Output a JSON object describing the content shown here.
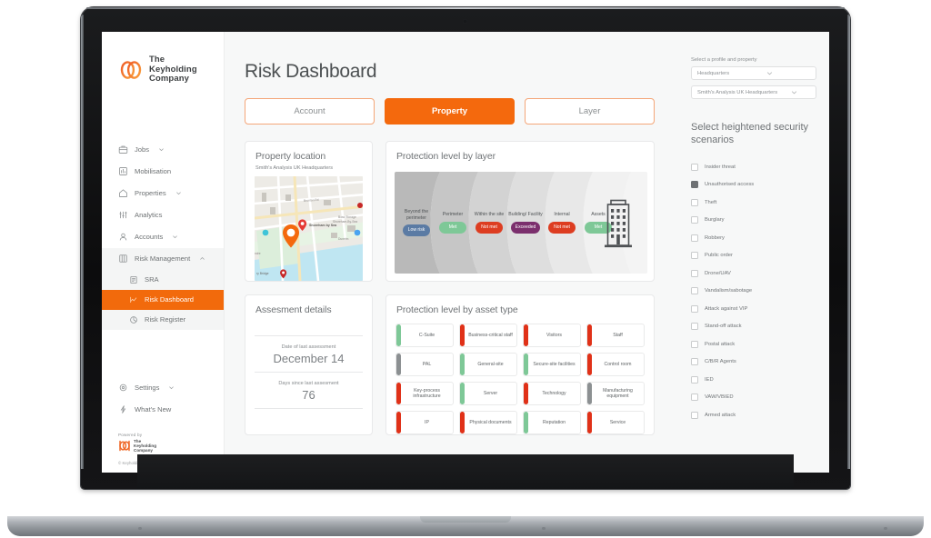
{
  "brand": {
    "logo_line1": "The",
    "logo_line2": "Keyholding",
    "logo_line3": "Company",
    "accent": "#f4690d",
    "powered_by": "Powered by",
    "copyright": "© Keyholding Technology"
  },
  "sidebar": {
    "items": [
      {
        "label": "Jobs",
        "icon": "briefcase-icon",
        "chevron": "down"
      },
      {
        "label": "Mobilisation",
        "icon": "bar-chart-icon",
        "chevron": "none"
      },
      {
        "label": "Properties",
        "icon": "home-icon",
        "chevron": "down"
      },
      {
        "label": "Analytics",
        "icon": "analytics-icon",
        "chevron": "none"
      },
      {
        "label": "Accounts",
        "icon": "user-icon",
        "chevron": "down"
      },
      {
        "label": "Risk Management",
        "icon": "columns-icon",
        "chevron": "up"
      }
    ],
    "sub_items": [
      {
        "label": "SRA",
        "icon": "document-icon",
        "active": false
      },
      {
        "label": "Risk Dashboard",
        "icon": "line-chart-icon",
        "active": true
      },
      {
        "label": "Risk Register",
        "icon": "pie-chart-icon",
        "active": false
      }
    ],
    "bottom_items": [
      {
        "label": "Settings",
        "icon": "gear-icon",
        "chevron": "down"
      },
      {
        "label": "What's New",
        "icon": "lightning-icon",
        "chevron": "none"
      }
    ]
  },
  "main": {
    "page_title": "Risk Dashboard",
    "tabs": [
      {
        "label": "Account",
        "active": false
      },
      {
        "label": "Property",
        "active": true
      },
      {
        "label": "Layer",
        "active": false
      }
    ],
    "property_location": {
      "title": "Property location",
      "subtitle": "Smith's Analysis UK Headquarters",
      "map_labels": [
        "Brunton Rd",
        "Shoreham by Sea",
        "Boss Storage Shoreham-By-Sea",
        "Dunelm",
        "Ferry Bridge"
      ]
    },
    "assessment": {
      "title": "Assesment details",
      "rows": [
        {
          "label": "Date of last assessment",
          "value": "December 14"
        },
        {
          "label": "Days since last assesment",
          "value": "76"
        }
      ]
    },
    "protection_by_layer": {
      "title": "Protection level by layer",
      "layers": [
        {
          "name": "Beyond the perimeter",
          "status": "Low risk",
          "color": "#5b7ba4"
        },
        {
          "name": "Perimeter",
          "status": "Met",
          "color": "#7ec897"
        },
        {
          "name": "Within the site",
          "status": "Not met",
          "color": "#dd3d21"
        },
        {
          "name": "Building/ Facility",
          "status": "Exceeded",
          "color": "#7b2f6d"
        },
        {
          "name": "Internal",
          "status": "Not met",
          "color": "#dd3d21"
        },
        {
          "name": "Assets",
          "status": "Met",
          "color": "#7ec897"
        }
      ],
      "building_icon": "office-building-icon"
    },
    "protection_by_asset": {
      "title": "Protection level by asset type",
      "assets": [
        {
          "label": "C-Suite",
          "color": "#7ec897"
        },
        {
          "label": "Business-critical staff",
          "color": "#e03118"
        },
        {
          "label": "Visitors",
          "color": "#e03118"
        },
        {
          "label": "Staff",
          "color": "#e03118"
        },
        {
          "label": "PAL",
          "color": "#8c9092"
        },
        {
          "label": "General-site",
          "color": "#7ec897"
        },
        {
          "label": "Secure-site facilities",
          "color": "#7ec897"
        },
        {
          "label": "Control room",
          "color": "#e03118"
        },
        {
          "label": "Key-process infrastructure",
          "color": "#e03118"
        },
        {
          "label": "Server",
          "color": "#7ec897"
        },
        {
          "label": "Technology",
          "color": "#e03118"
        },
        {
          "label": "Manufacturing equipment",
          "color": "#8c9092"
        },
        {
          "label": "IP",
          "color": "#e03118"
        },
        {
          "label": "Physical documents",
          "color": "#e03118"
        },
        {
          "label": "Reputation",
          "color": "#7ec897"
        },
        {
          "label": "Service",
          "color": "#e03118"
        }
      ]
    }
  },
  "rail": {
    "profile_label": "Select a profile and property",
    "profile_select": {
      "value": "Headquarters"
    },
    "property_select": {
      "value": "Smith's Analysis UK Headquarters"
    },
    "scenarios_title": "Select heightened security scenarios",
    "scenarios": [
      {
        "label": "Insider threat",
        "checked": false
      },
      {
        "label": "Unauthorised access",
        "checked": true
      },
      {
        "label": "Theft",
        "checked": false
      },
      {
        "label": "Burglary",
        "checked": false
      },
      {
        "label": "Robbery",
        "checked": false
      },
      {
        "label": "Public order",
        "checked": false
      },
      {
        "label": "Drone/UAV",
        "checked": false
      },
      {
        "label": "Vandalism/sabotage",
        "checked": false
      },
      {
        "label": "Attack against VIP",
        "checked": false
      },
      {
        "label": "Stand-off attack",
        "checked": false
      },
      {
        "label": "Postal attack",
        "checked": false
      },
      {
        "label": "C/B/R Agents",
        "checked": false
      },
      {
        "label": "IED",
        "checked": false
      },
      {
        "label": "VAW/VBIED",
        "checked": false
      },
      {
        "label": "Armed attack",
        "checked": false
      }
    ]
  }
}
